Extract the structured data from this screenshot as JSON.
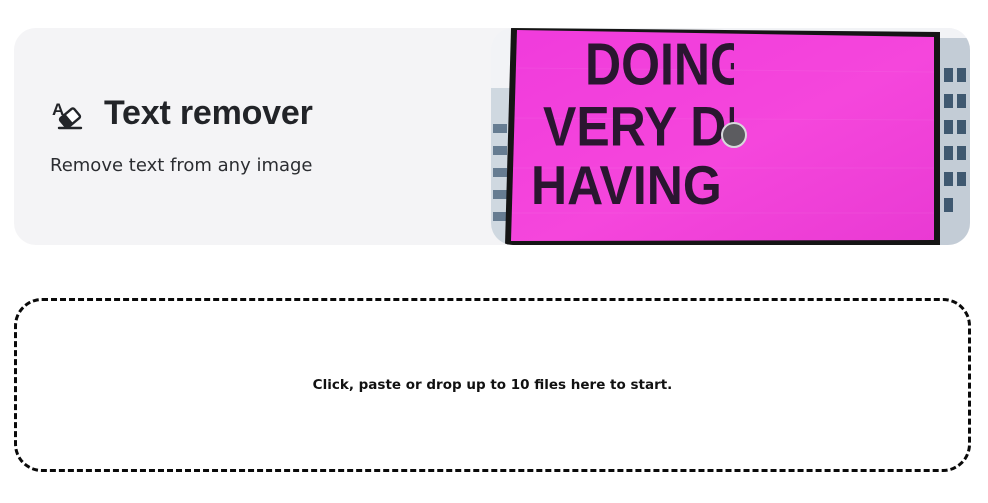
{
  "hero": {
    "title": "Text remover",
    "subtitle": "Remove text from any image",
    "icon": "eraser-text-icon"
  },
  "preview": {
    "billboard_lines": [
      "DOING N",
      "VERY DIFF",
      "HAVING NO"
    ],
    "billboard_color": "#f23fd9",
    "compare_position": 0.5
  },
  "dropzone": {
    "label": "Click, paste or drop up to 10 files here to start."
  }
}
